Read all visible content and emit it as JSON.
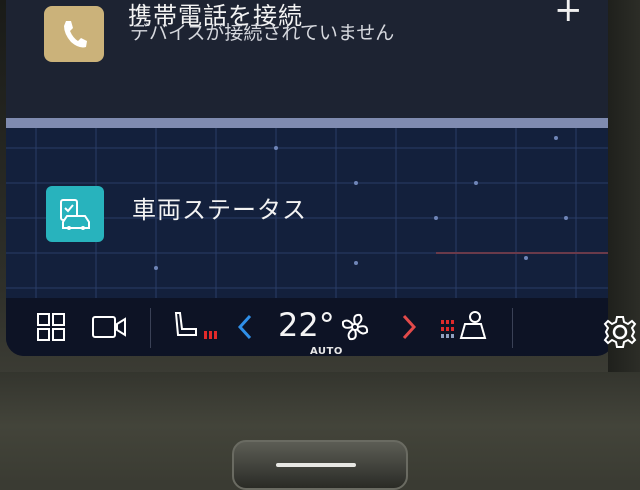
{
  "phone_card": {
    "title": "携帯電話を接続",
    "subtitle": "デバイスが接続されていません",
    "add_symbol": "+",
    "icon": "phone-icon"
  },
  "vehicle_card": {
    "title": "車両ステータス",
    "icon": "vehicle-status-icon"
  },
  "climate_bar": {
    "temperature": "22°",
    "mode": "AUTO",
    "icons": [
      "apps-grid-icon",
      "camera-icon",
      "seat-heat-icon",
      "chevron-left-icon",
      "fan-icon",
      "chevron-right-icon",
      "seat-ventilation-icon",
      "settings-icon"
    ]
  },
  "colors": {
    "phone_icon_bg": "#cbb27a",
    "vehicle_icon_bg": "#28b3bd",
    "left_chevron": "#2f8fe8",
    "right_chevron": "#e24a4a",
    "seat_heat_red": "#e02a2a"
  }
}
